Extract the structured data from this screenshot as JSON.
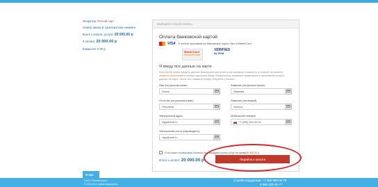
{
  "sidebar": {
    "operator_label": "Оператор:",
    "operator_value": "Речной порт",
    "booking_link": "Номер заказа и туроператора нажмите",
    "order_total_label": "Всего к оплате, услуги:",
    "order_total_value": "20 000.00 р",
    "to_pay_label": "К оплате:",
    "to_pay_value": "20 000.00 р",
    "commission_label": "Комиссия:",
    "commission_value": "0.00 р"
  },
  "panel": {
    "header": "Выберите способ оплаты",
    "title": "Оплата банковской картой",
    "cards_hint": "К оплате принимаются банковские карты Visa и MasterCard",
    "visa_text": "VISA",
    "mc_secure_line1": "MasterCard",
    "mc_secure_line2": "SecureCode",
    "vbv_line1": "VERIFIED",
    "vbv_line2": "by VISA",
    "form_title": "Я введу все данные на карте",
    "form_note_a": "Если вы не хотите вводить данные банковской карты или у вас возникли сложности с оплатой, вы можете",
    "form_note_link": "оплатить наличными",
    "form_note_b": "в любом отделении банка. Внимательно проверьте правильность заполнения полей и данных на карте, после чего нажмите кнопку «Перейти к оплате»."
  },
  "fields": [
    {
      "label": "Имя (на русском языке)",
      "value": "Ольга"
    },
    {
      "label": "Фамилия (на русском языке)",
      "value": "Иванова"
    },
    {
      "label": "Отчество (на русском языке)",
      "value": "Петровна"
    },
    {
      "label": "Фамилия (латиницей)",
      "value": "Ivanova"
    },
    {
      "label": "Мобильный телефон",
      "value": "+7 (999) 000-00-00"
    },
    {
      "label": "Электронный адрес",
      "value": "olga@mail.ru"
    },
    {
      "label": "Электронная почта (подтвердить)",
      "value": "olga@mail.ru"
    }
  ],
  "agree": {
    "text": "Я согласен с ",
    "link": "правилами оплаты",
    "rest": " и подтверждаю оплату услуг на сумму ",
    "amount": "20 000.00 р"
  },
  "total": {
    "label": "Итого к оплате:",
    "value": "20 000.00 р"
  },
  "pay_button": "Перейти к оплате",
  "footer": {
    "tab": "О нас",
    "left_line1": "ООО «Речной порт»",
    "left_line2": "© 2014 Все права защищены",
    "phone_label": "Служба поддержки:",
    "phone1": "+7 495 995-06-78",
    "phone2": "8 800 333-30-77"
  },
  "colors": {
    "accent": "#41a8dc",
    "button": "#c0392b",
    "highlight_ring": "#d9232a"
  }
}
